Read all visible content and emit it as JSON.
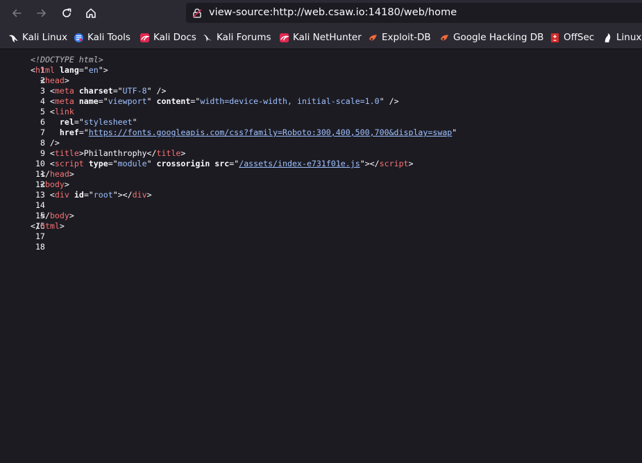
{
  "toolbar": {
    "url": "view-source:http://web.csaw.io:14180/web/home"
  },
  "bookmarks": [
    {
      "label": "Kali Linux",
      "icon": "kali-dragon-icon"
    },
    {
      "label": "Kali Tools",
      "icon": "kali-tools-icon"
    },
    {
      "label": "Kali Docs",
      "icon": "kali-docs-icon"
    },
    {
      "label": "Kali Forums",
      "icon": "kali-forums-icon"
    },
    {
      "label": "Kali NetHunter",
      "icon": "kali-nethunter-icon"
    },
    {
      "label": "Exploit-DB",
      "icon": "exploit-db-icon"
    },
    {
      "label": "Google Hacking DB",
      "icon": "ghdb-icon"
    },
    {
      "label": "OffSec",
      "icon": "offsec-icon"
    },
    {
      "label": "Linux",
      "icon": "kali-dragon-icon"
    }
  ],
  "source": {
    "line_numbers": [
      "1",
      "2",
      "3",
      "4",
      "5",
      "6",
      "7",
      "8",
      "9",
      "10",
      "11",
      "12",
      "13",
      "14",
      "15",
      "16",
      "17",
      "18"
    ],
    "tokens": {
      "doctype": "<!DOCTYPE html>",
      "html": "html",
      "lang": "lang",
      "en": "en",
      "head": "head",
      "meta": "meta",
      "charset": "charset",
      "utf8": "UTF-8",
      "name": "name",
      "viewport": "viewport",
      "content": "content",
      "viewport_content": "width=device-width, initial-scale=1.0",
      "link": "link",
      "rel": "rel",
      "stylesheet": "stylesheet",
      "href": "href",
      "fonts_url": "https://fonts.googleapis.com/css?family=Roboto:300,400,500,700&display=swap",
      "title": "title",
      "title_text": "Philanthrophy",
      "script": "script",
      "type": "type",
      "module": "module",
      "crossorigin": "crossorigin",
      "src": "src",
      "script_src": "/assets/index-e731f01e.js",
      "body": "body",
      "div": "div",
      "id": "id",
      "root": "root"
    }
  },
  "colors": {
    "tag": "#f87272",
    "attribute": "#fbfbfe",
    "value": "#9ec1ff",
    "background": "#1c1b22",
    "toolbar": "#2b2a33"
  }
}
